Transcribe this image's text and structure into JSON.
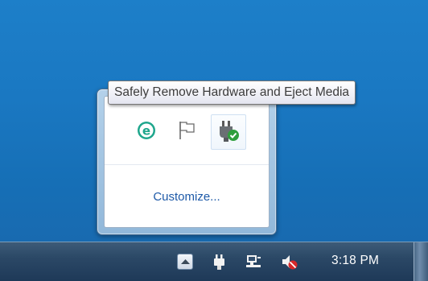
{
  "tooltip": {
    "text": "Safely Remove Hardware and Eject Media"
  },
  "flyout": {
    "icons": [
      "eset-icon",
      "action-center-flag-icon",
      "safely-remove-hardware-icon"
    ],
    "customize_label": "Customize..."
  },
  "taskbar": {
    "tray_icons": [
      "show-hidden-icons-arrow",
      "power-plug-icon",
      "network-icon",
      "volume-muted-icon"
    ],
    "clock": "3:18 PM"
  },
  "colors": {
    "desktop": "#1a78c2",
    "taskbar": "#2b4866",
    "link": "#1e5aa8",
    "eset_green": "#1ea68c"
  }
}
